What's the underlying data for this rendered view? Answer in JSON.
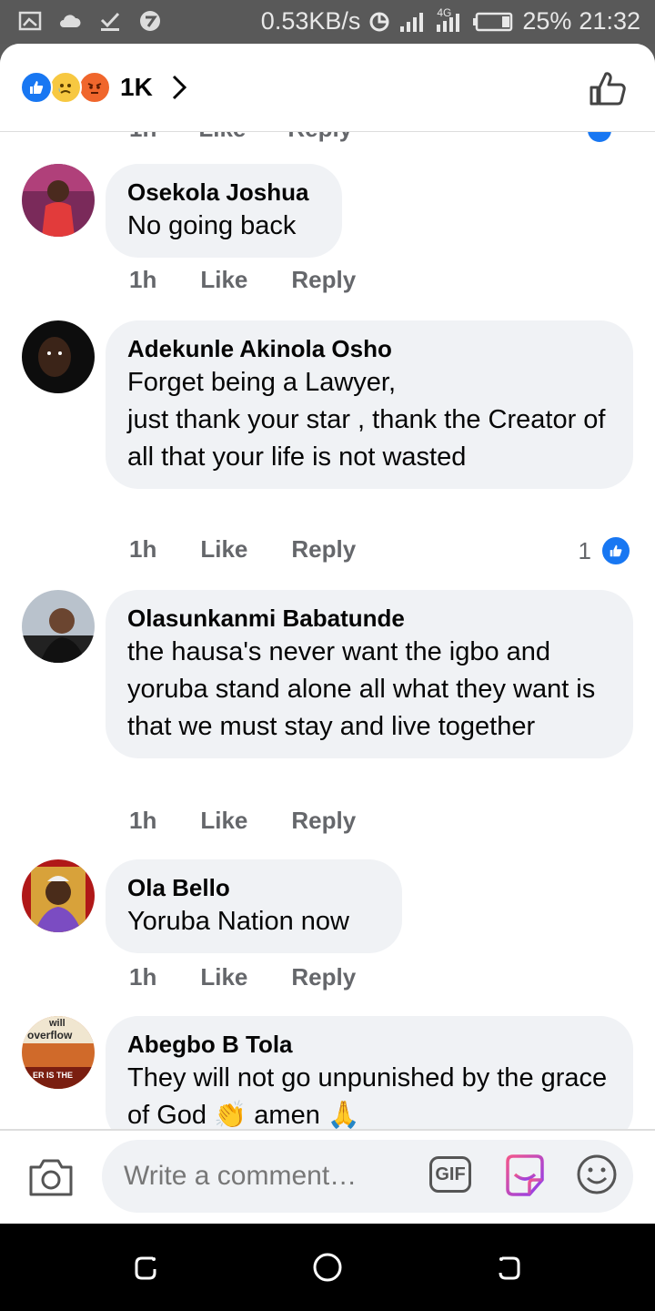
{
  "status_bar": {
    "network_speed": "0.53KB/s",
    "network_type": "4G",
    "battery": "25%",
    "time": "21:32",
    "left_icons": [
      "screenshot-icon",
      "cloud-icon",
      "download-done-icon",
      "app-icon"
    ]
  },
  "reactions": {
    "types": [
      "like",
      "sad",
      "angry"
    ],
    "count": "1K"
  },
  "partial_top_row": {
    "time": "1h",
    "like": "Like",
    "reply": "Reply"
  },
  "comments": [
    {
      "author": "Osekola Joshua",
      "text": "No going back",
      "time": "1h",
      "like": "Like",
      "reply": "Reply"
    },
    {
      "author": "Adekunle Akinola Osho",
      "text": "Forget being a Lawyer,\njust thank your star , thank the Creator of all that your life is not wasted",
      "time": "1h",
      "like": "Like",
      "reply": "Reply",
      "reaction_count": "1"
    },
    {
      "author": "Olasunkanmi Babatunde",
      "text": "the hausa's never want the igbo and yoruba stand alone all what they want is that we must stay and live together",
      "time": "1h",
      "like": "Like",
      "reply": "Reply"
    },
    {
      "author": "Ola Bello",
      "text": "Yoruba Nation now",
      "time": "1h",
      "like": "Like",
      "reply": "Reply"
    },
    {
      "author": "Abegbo B Tola",
      "text": "They will not go unpunished by the grace of God 👏 amen 🙏",
      "time": "",
      "like": "",
      "reply": ""
    }
  ],
  "avatar5_text": [
    "will",
    "overflow",
    "ER IS THE"
  ],
  "composer": {
    "placeholder": "Write a comment…",
    "gif_label": "GIF"
  },
  "colors": {
    "accent": "#1877f2",
    "bubble": "#f0f2f5",
    "meta_text": "#65676b"
  }
}
